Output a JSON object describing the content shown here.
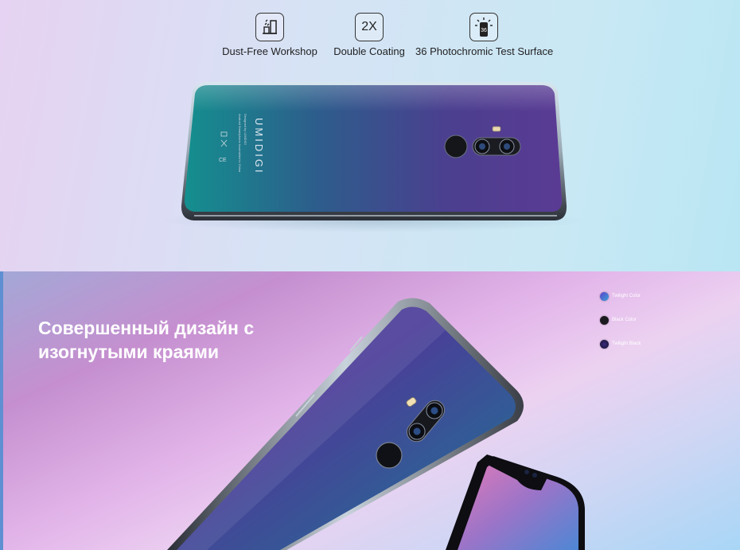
{
  "features": [
    {
      "icon": "dust-free-workshop-icon",
      "label": "Dust-Free Workshop"
    },
    {
      "icon": "double-coating-icon",
      "text": "2X",
      "label": "Double Coating"
    },
    {
      "icon": "photochromic-test-icon",
      "text": "36",
      "label": "36 Photochromic Test Surface"
    }
  ],
  "phone": {
    "brand": "UMIDIGI",
    "back_text": [
      "Designed by UMIDIGI",
      "Android Smartphone Assembled in China"
    ]
  },
  "headline": [
    "Совершенный дизайн с",
    "изогнутыми краями"
  ],
  "colors": [
    {
      "name": "Twilight Color",
      "hex": "#3d62c4"
    },
    {
      "name": "Black Color",
      "hex": "#1b1b1f"
    },
    {
      "name": "Twilight Black",
      "hex": "#2a1a5e"
    }
  ]
}
